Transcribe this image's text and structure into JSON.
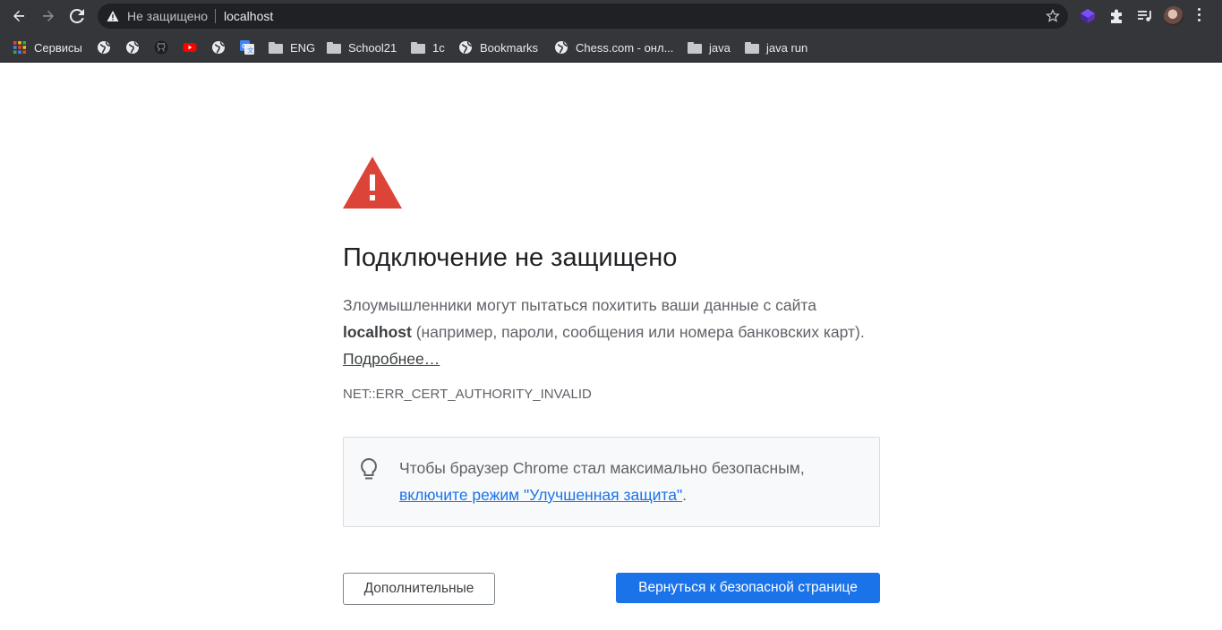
{
  "browser": {
    "security_label": "Не защищено",
    "url": "localhost"
  },
  "bookmarks": [
    {
      "label": "Сервисы",
      "icon": "apps-grid-icon"
    },
    {
      "label": "",
      "icon": "globe-icon"
    },
    {
      "label": "",
      "icon": "globe-icon"
    },
    {
      "label": "",
      "icon": "github-icon"
    },
    {
      "label": "",
      "icon": "youtube-icon"
    },
    {
      "label": "",
      "icon": "globe-icon"
    },
    {
      "label": "",
      "icon": "google-translate-icon"
    },
    {
      "label": "ENG",
      "icon": "folder-icon"
    },
    {
      "label": "School21",
      "icon": "folder-icon"
    },
    {
      "label": "1c",
      "icon": "folder-icon"
    },
    {
      "label": "Bookmarks",
      "icon": "globe-icon"
    },
    {
      "label": "Chess.com - онл...",
      "icon": "globe-icon"
    },
    {
      "label": "java",
      "icon": "folder-icon"
    },
    {
      "label": "java run",
      "icon": "folder-icon"
    }
  ],
  "interstitial": {
    "title": "Подключение не защищено",
    "desc_before": "Злоумышленники могут пытаться похитить ваши данные с сайта ",
    "desc_host": "localhost",
    "desc_after": " (например, пароли, сообщения или номера банковских карт). ",
    "learn_more": "Подробнее…",
    "error_code": "NET::ERR_CERT_AUTHORITY_INVALID",
    "tip_text": "Чтобы браузер Chrome стал максимально безопасным, ",
    "tip_link": "включите режим \"Улучшенная защита\"",
    "tip_end": ".",
    "advanced_button": "Дополнительные",
    "back_button": "Вернуться к безопасной странице"
  },
  "colors": {
    "toolbar": "#35363a",
    "warning_red": "#db4437",
    "link_blue": "#1a73e8",
    "primary_button": "#1a73e8"
  }
}
